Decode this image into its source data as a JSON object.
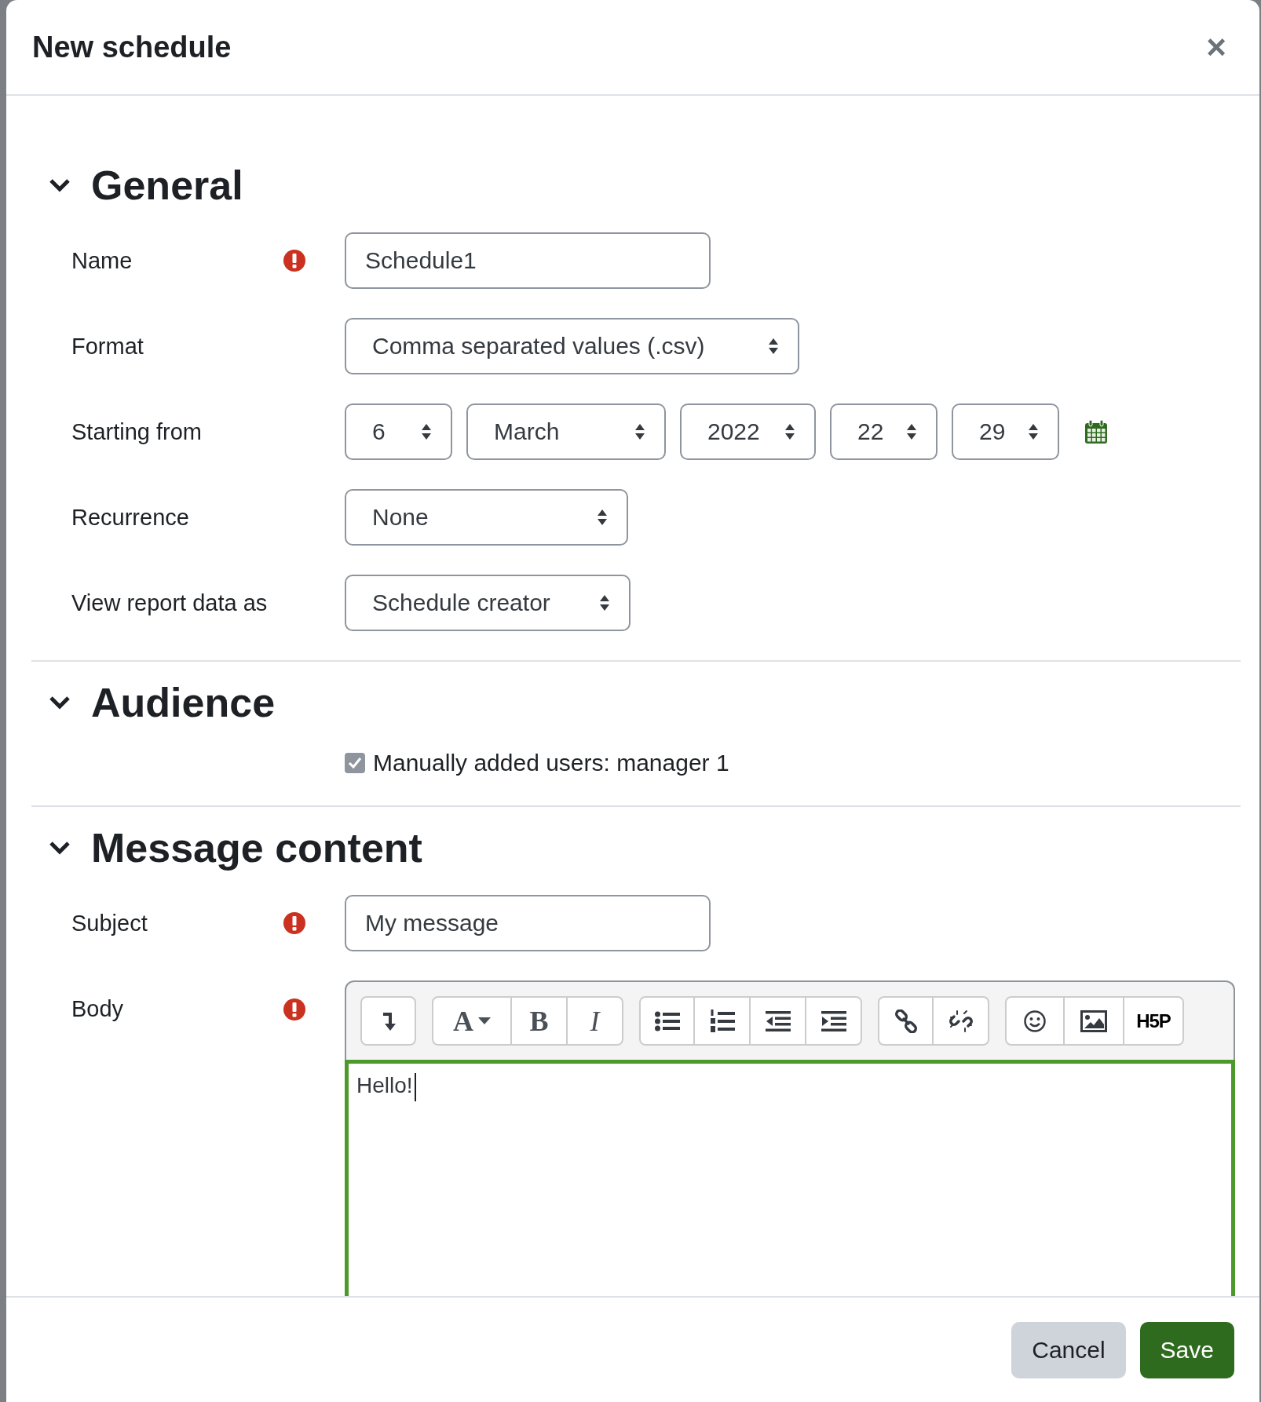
{
  "dialog": {
    "title": "New schedule",
    "close": "×"
  },
  "sections": [
    {
      "title": "General",
      "expanded": true,
      "fields": [
        {
          "kind": "text",
          "label": "Name",
          "required": true,
          "value": "Schedule1"
        },
        {
          "kind": "select",
          "label": "Format",
          "required": false,
          "value": "Comma separated values (.csv)"
        },
        {
          "kind": "datetime",
          "label": "Starting from",
          "required": false,
          "parts": [
            "6",
            "March",
            "2022",
            "22",
            "29"
          ]
        },
        {
          "kind": "select",
          "label": "Recurrence",
          "required": false,
          "value": "None"
        },
        {
          "kind": "select",
          "label": "View report data as",
          "required": false,
          "value": "Schedule creator"
        }
      ]
    },
    {
      "title": "Audience",
      "expanded": true,
      "fields": [
        {
          "kind": "checkbox",
          "label": "Manually added users: manager 1",
          "checked": true
        }
      ]
    },
    {
      "title": "Message content",
      "expanded": true,
      "fields": [
        {
          "kind": "text",
          "label": "Subject",
          "required": true,
          "value": "My message"
        },
        {
          "kind": "editor",
          "label": "Body",
          "required": true,
          "focused": true,
          "value": "Hello!",
          "toolbar": [
            [
              {
                "kind": "collapse"
              }
            ],
            [
              {
                "kind": "font",
                "label": "A"
              },
              {
                "kind": "bold",
                "label": "B"
              },
              {
                "kind": "italic",
                "label": "I"
              }
            ],
            [
              {
                "kind": "bullets"
              },
              {
                "kind": "numbers"
              },
              {
                "kind": "outdent"
              },
              {
                "kind": "indent"
              }
            ],
            [
              {
                "kind": "link"
              },
              {
                "kind": "unlink"
              }
            ],
            [
              {
                "kind": "emoji"
              },
              {
                "kind": "image"
              },
              {
                "kind": "h5p",
                "label": "H5P"
              }
            ]
          ]
        }
      ]
    }
  ],
  "footer": {
    "buttons": [
      {
        "kind": "secondary",
        "label": "Cancel"
      },
      {
        "kind": "primary",
        "label": "Save"
      }
    ]
  }
}
